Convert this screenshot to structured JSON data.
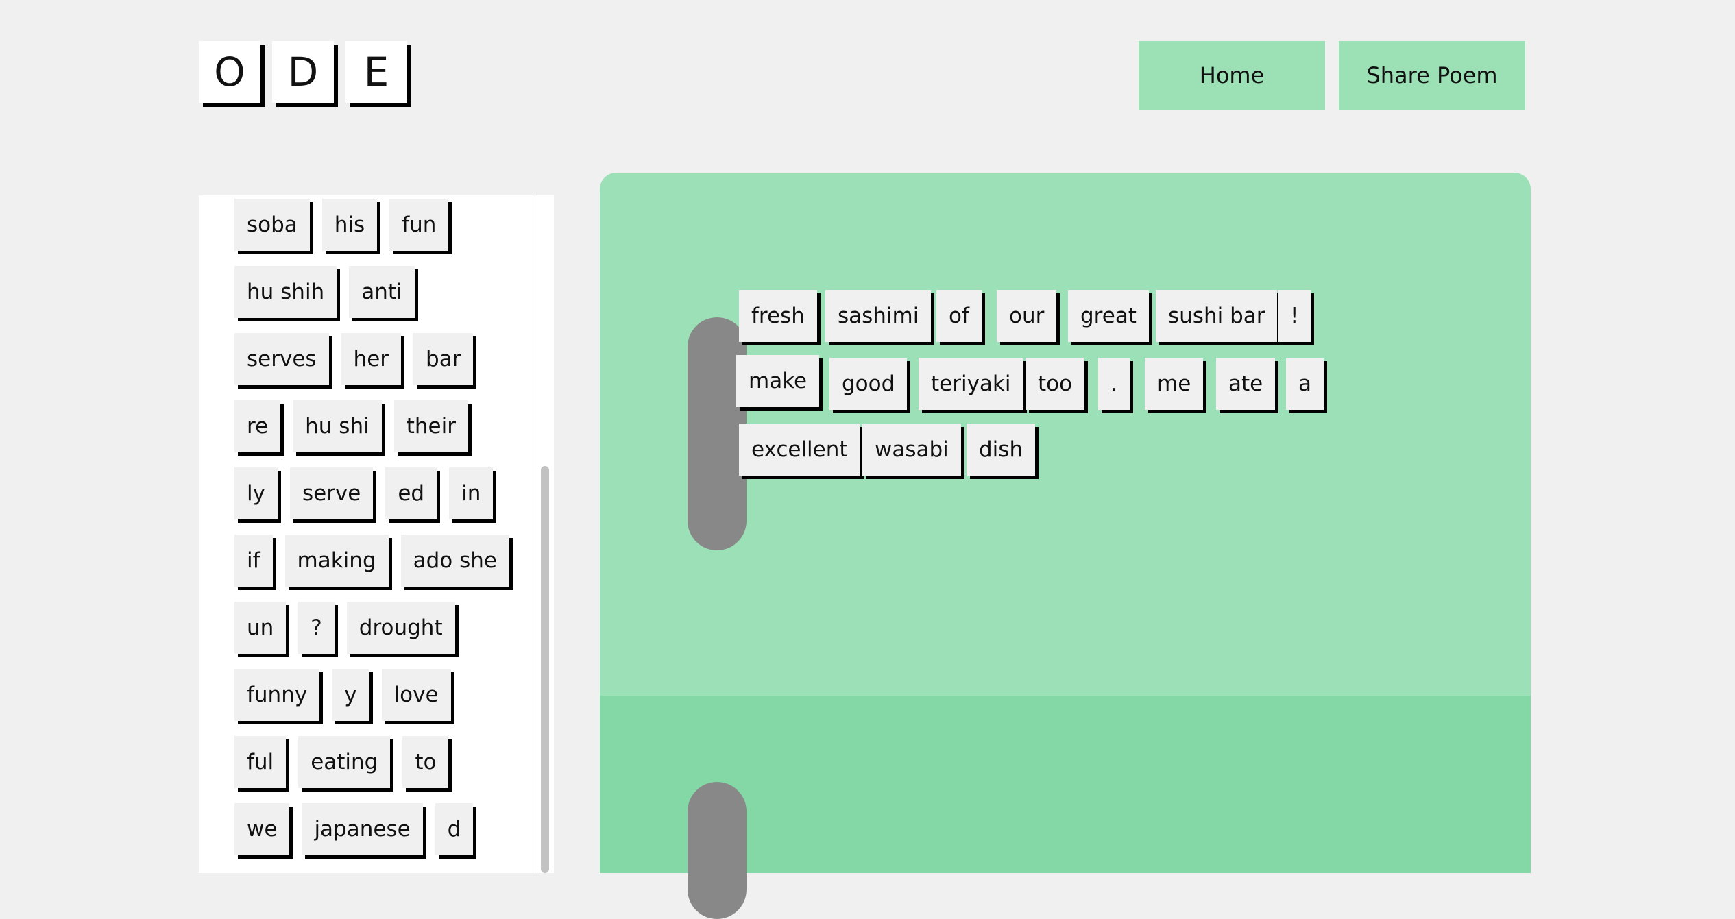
{
  "logo": {
    "letters": [
      "O",
      "D",
      "E"
    ]
  },
  "nav": {
    "home_label": "Home",
    "share_label": "Share Poem"
  },
  "word_bank": {
    "rows": [
      [
        "soba",
        "his",
        "fun"
      ],
      [
        "hu shih",
        "anti"
      ],
      [
        "serves",
        "her",
        "bar"
      ],
      [
        "re",
        "hu shi",
        "their"
      ],
      [
        "ly",
        "serve",
        "ed",
        "in"
      ],
      [
        "if",
        "making",
        "ado she"
      ],
      [
        "un",
        "?",
        "drought"
      ],
      [
        "funny",
        "y",
        "love"
      ],
      [
        "ful",
        "eating",
        "to"
      ],
      [
        "we",
        "japanese",
        "d"
      ]
    ]
  },
  "poem": {
    "words": [
      "fresh",
      "sashimi",
      "of",
      "our",
      "great",
      "sushi bar",
      "!",
      "make",
      "good",
      "teriyaki",
      "too",
      ".",
      "me",
      "ate",
      "a",
      "excellent",
      "wasabi",
      "dish"
    ]
  },
  "colors": {
    "fridge_top": "#9ce0b7",
    "fridge_bottom": "#83d8a6",
    "button": "#9ce0b5",
    "handle": "#888888"
  }
}
